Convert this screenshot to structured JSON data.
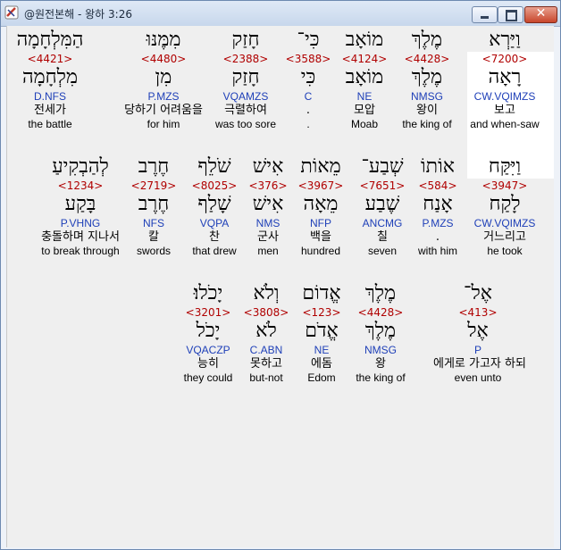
{
  "window": {
    "title": "@원전본해 - 왕하 3:26",
    "close_symbol": "✕"
  },
  "rows": [
    {
      "words": [
        {
          "heb": "וַיַּרְא",
          "strong": "<7200>",
          "lex": "רָאָה",
          "morph": "CW.VQIMZS",
          "kor": "보고",
          "eng": "and when-saw"
        },
        {
          "heb": "מֶלֶךְ",
          "strong": "<4428>",
          "lex": "מֶלֶךְ",
          "morph": "NMSG",
          "kor": "왕이",
          "eng": "the king of"
        },
        {
          "heb": "מוֹאָב",
          "strong": "<4124>",
          "lex": "מוֹאָב",
          "morph": "NE",
          "kor": "모압",
          "eng": "Moab"
        },
        {
          "heb": "כִּי־",
          "strong": "<3588>",
          "lex": "כִּי",
          "morph": "C",
          "kor": ".",
          "eng": "."
        },
        {
          "heb": "חָזַק",
          "strong": "<2388>",
          "lex": "חָזַק",
          "morph": "VQAMZS",
          "kor": "극렬하여",
          "eng": "was too sore"
        },
        {
          "heb": "מִמֶּנּוּ",
          "strong": "<4480>",
          "lex": "מִן",
          "morph": "P.MZS",
          "kor": "당하기 어려움을",
          "eng": "for him"
        },
        {
          "heb": "הַמִּלְחָמָה",
          "strong": "<4421>",
          "lex": "מִלְחָמָה",
          "morph": "D.NFS",
          "kor": "전세가",
          "eng": "the battle"
        }
      ]
    },
    {
      "words": [
        {
          "heb": "וַיִּקַּח",
          "strong": "<3947>",
          "lex": "לָקַח",
          "morph": "CW.VQIMZS",
          "kor": "거느리고",
          "eng": "he took"
        },
        {
          "heb": "אוֹתוֹ",
          "strong": "<584>",
          "lex": "אָנַח",
          "morph": "P.MZS",
          "kor": ".",
          "eng": "with him"
        },
        {
          "heb": "שְׁבַע־",
          "strong": "<7651>",
          "lex": "שֶׁבַע",
          "morph": "ANCMG",
          "kor": "칠",
          "eng": "seven"
        },
        {
          "heb": "מֵאוֹת",
          "strong": "<3967>",
          "lex": "מֵאָה",
          "morph": "NFP",
          "kor": "백을",
          "eng": "hundred"
        },
        {
          "heb": "אִישׁ",
          "strong": "<376>",
          "lex": "אִישׁ",
          "morph": "NMS",
          "kor": "군사",
          "eng": "men"
        },
        {
          "heb": "שֹׁלֵף",
          "strong": "<8025>",
          "lex": "שָׁלַף",
          "morph": "VQPA",
          "kor": "찬",
          "eng": "that drew"
        },
        {
          "heb": "חֶרֶב",
          "strong": "<2719>",
          "lex": "חֶרֶב",
          "morph": "NFS",
          "kor": "칼",
          "eng": "swords"
        },
        {
          "heb": "לְהַבְקִיעַ",
          "strong": "<1234>",
          "lex": "בָּקַע",
          "morph": "P.VHNG",
          "kor": "충돌하며 지나서",
          "eng": "to break through"
        }
      ]
    },
    {
      "words": [
        {
          "heb": "אֶל־",
          "strong": "<413>",
          "lex": "אֶל",
          "morph": "P",
          "kor": "에게로 가고자 하되",
          "eng": "even unto"
        },
        {
          "heb": "מֶלֶךְ",
          "strong": "<4428>",
          "lex": "מֶלֶךְ",
          "morph": "NMSG",
          "kor": "왕",
          "eng": "the king of"
        },
        {
          "heb": "אֱדוֹם",
          "strong": "<123>",
          "lex": "אֱדֹם",
          "morph": "NE",
          "kor": "에돔",
          "eng": "Edom"
        },
        {
          "heb": "וְלֹא",
          "strong": "<3808>",
          "lex": "לֹא",
          "morph": "C.ABN",
          "kor": "못하고",
          "eng": "but-not"
        },
        {
          "heb": "יָכֹלוּ׃",
          "strong": "<3201>",
          "lex": "יָכֹל",
          "morph": "VQACZP",
          "kor": "능히",
          "eng": "they could"
        }
      ]
    }
  ]
}
